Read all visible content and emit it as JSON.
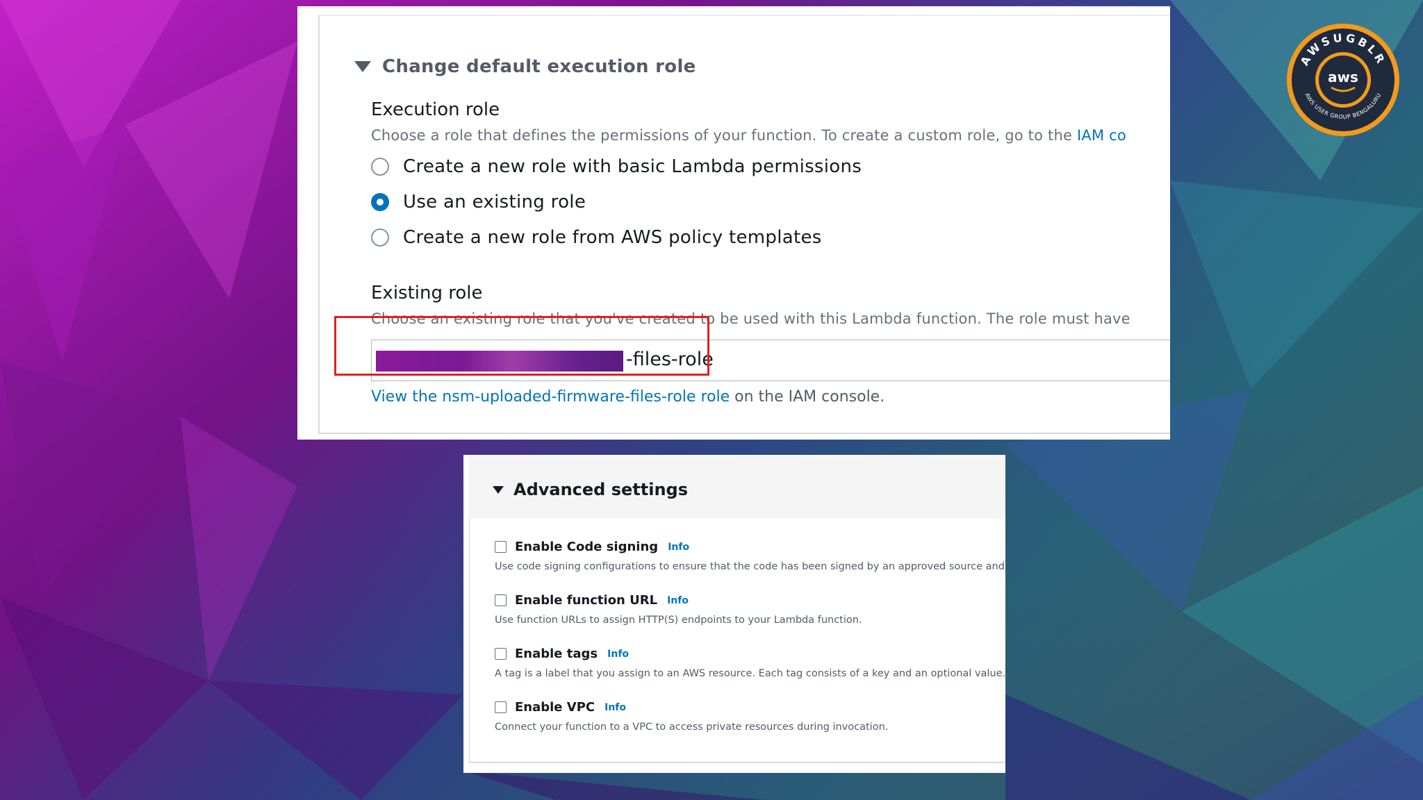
{
  "execution_role_section": {
    "expander_label": "Change default execution role",
    "field_label": "Execution role",
    "description": "Choose a role that defines the permissions of your function. To create a custom role, go to the",
    "description_link": "IAM co",
    "options": [
      {
        "label": "Create a new role with basic Lambda permissions",
        "selected": false
      },
      {
        "label": "Use an existing role",
        "selected": true
      },
      {
        "label": "Create a new role from AWS policy templates",
        "selected": false
      }
    ]
  },
  "existing_role": {
    "label": "Existing role",
    "description": "Choose an existing role that you've created to be used with this Lambda function. The role must have",
    "selected_value_visible": "-files-role",
    "view_link": "View the nsm-uploaded-firmware-files-role role",
    "view_suffix": "on the IAM console."
  },
  "advanced_settings": {
    "title": "Advanced settings",
    "options": [
      {
        "label": "Enable Code signing",
        "info": "Info",
        "description": "Use code signing configurations to ensure that the code has been signed by an approved source and",
        "checked": false
      },
      {
        "label": "Enable function URL",
        "info": "Info",
        "description": "Use function URLs to assign HTTP(S) endpoints to your Lambda function.",
        "checked": false
      },
      {
        "label": "Enable tags",
        "info": "Info",
        "description": "A tag is a label that you assign to an AWS resource. Each tag consists of a key and an optional value.",
        "checked": false
      },
      {
        "label": "Enable VPC",
        "info": "Info",
        "description": "Connect your function to a VPC to access private resources during invocation.",
        "checked": false
      }
    ]
  },
  "logo": {
    "ring_text": "AWSUGBLR",
    "center_text": "aws",
    "bottom_text": "AWS USER GROUP BENGALURU"
  },
  "colors": {
    "link": "#0073bb",
    "radio_selected": "#0073bb",
    "highlight_box": "#e02020",
    "logo_orange": "#f39a1e"
  }
}
